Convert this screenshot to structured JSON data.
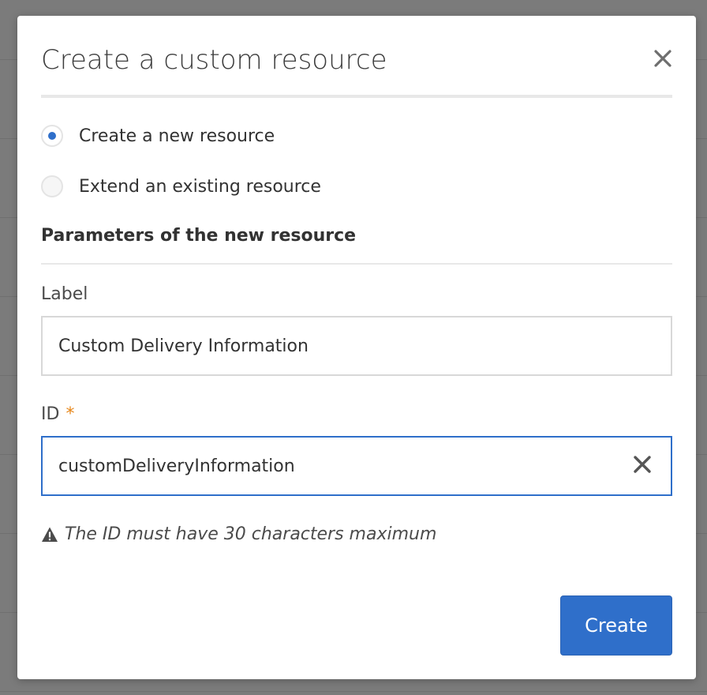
{
  "dialog": {
    "title": "Create a custom resource",
    "close_icon": "close-icon"
  },
  "options": {
    "create_new": {
      "label": "Create a new resource",
      "checked": true
    },
    "extend_existing": {
      "label": "Extend an existing resource",
      "checked": false
    }
  },
  "section": {
    "heading": "Parameters of the new resource"
  },
  "fields": {
    "label": {
      "label": "Label",
      "value": "Custom Delivery Information"
    },
    "id": {
      "label": "ID",
      "required_mark": "*",
      "value": "customDeliveryInformation",
      "clear_icon": "clear-icon"
    }
  },
  "warning": {
    "icon": "warning-icon",
    "text": "The ID must have 30 characters maximum"
  },
  "actions": {
    "create_label": "Create"
  },
  "colors": {
    "accent": "#2f6fca",
    "required": "#e68619",
    "overlay": "#7b7b7b"
  }
}
